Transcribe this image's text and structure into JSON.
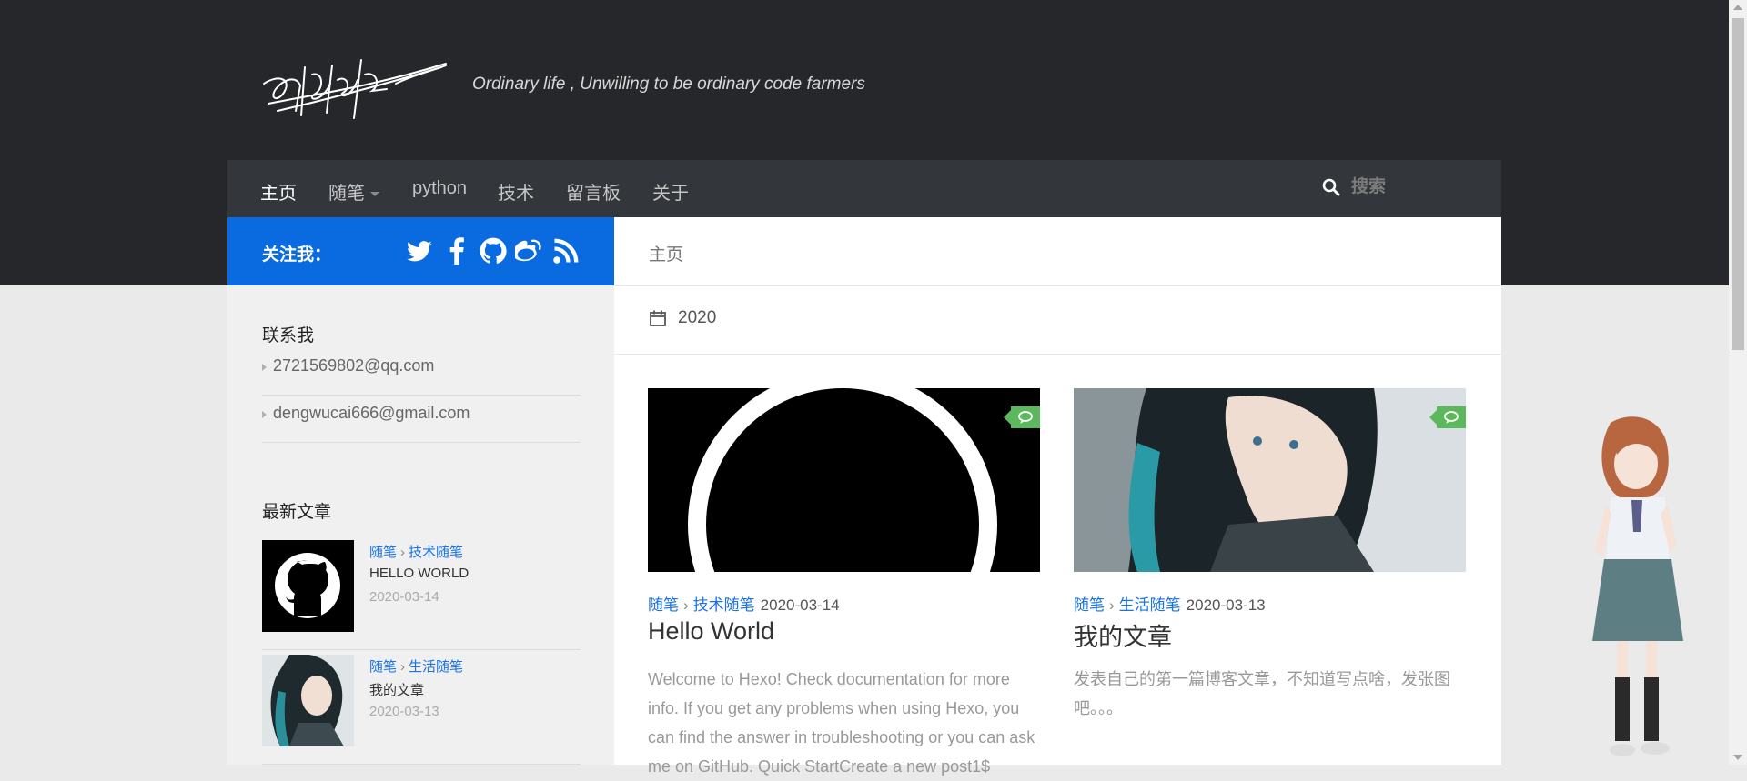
{
  "header": {
    "tagline": "Ordinary life , Unwilling to be ordinary code farmers"
  },
  "nav": {
    "items": [
      {
        "label": "主页",
        "active": true
      },
      {
        "label": "随笔",
        "dropdown": true
      },
      {
        "label": "python"
      },
      {
        "label": "技术"
      },
      {
        "label": "留言板"
      },
      {
        "label": "关于"
      }
    ],
    "search_placeholder": "搜索"
  },
  "follow": {
    "label": "关注我：",
    "icons": [
      "twitter-icon",
      "facebook-icon",
      "github-icon",
      "weibo-icon",
      "rss-icon"
    ]
  },
  "sidebar": {
    "contact_title": "联系我",
    "contacts": [
      "2721569802@qq.com",
      "dengwucai666@gmail.com"
    ],
    "recent_title": "最新文章",
    "recent": [
      {
        "cat1": "随笔",
        "cat2": "技术随笔",
        "title": "HELLO WORLD",
        "date": "2020-03-14"
      },
      {
        "cat1": "随笔",
        "cat2": "生活随笔",
        "title": "我的文章",
        "date": "2020-03-13"
      }
    ]
  },
  "main": {
    "breadcrumb": "主页",
    "archive_year": "2020",
    "posts": [
      {
        "cat1": "随笔",
        "cat2": "技术随笔",
        "date": "2020-03-14",
        "title": "Hello World",
        "excerpt": "Welcome to Hexo! Check documentation for more info. If you get any problems when using Hexo, you can find the answer in troubleshooting or you can ask me on GitHub. Quick StartCreate a new post1$"
      },
      {
        "cat1": "随笔",
        "cat2": "生活随笔",
        "date": "2020-03-13",
        "title": "我的文章",
        "excerpt": "发表自己的第一篇博客文章，不知道写点啥，发张图吧。。。"
      }
    ]
  },
  "colors": {
    "header_bg": "#26272b",
    "nav_bg": "#33363b",
    "accent_blue": "#0a6be0",
    "comment_badge": "#5cb85c",
    "link": "#1a73e8"
  }
}
